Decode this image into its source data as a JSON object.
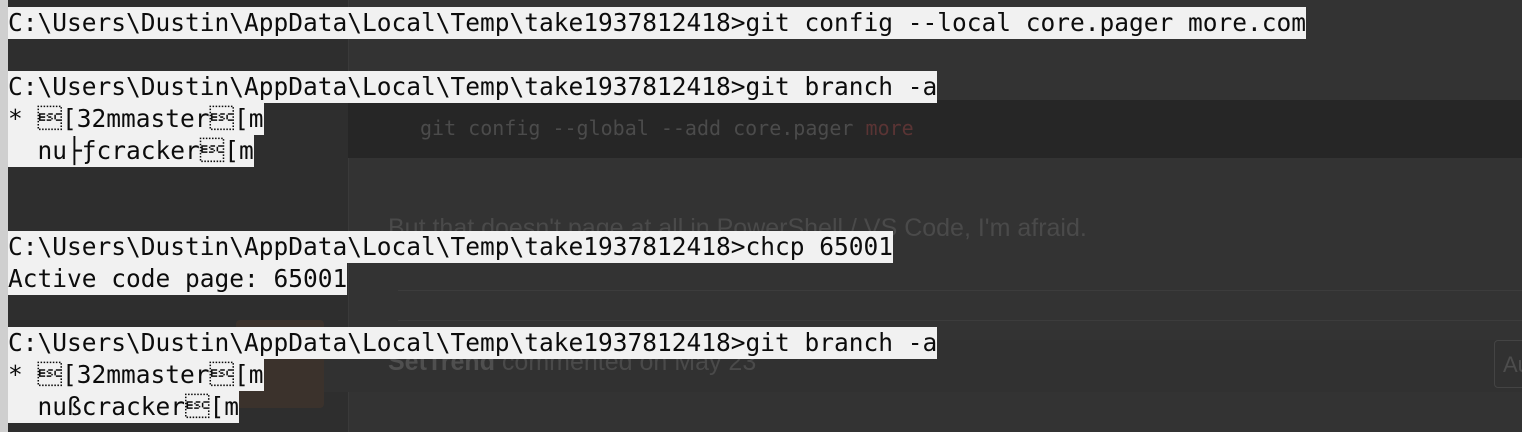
{
  "background_page": {
    "code_prefix": "git config --global --add core.pager ",
    "code_keyword": "more",
    "note": "But that doesn't page at all in PowerShell / VS Code, I'm afraid.",
    "comment_author": "SetTrend",
    "comment_text": " commented on May 23",
    "pill_text": "Au"
  },
  "console": {
    "lines": [
      "C:\\Users\\Dustin\\AppData\\Local\\Temp\\take1937812418>git config --local core.pager more.com",
      "C:\\Users\\Dustin\\AppData\\Local\\Temp\\take1937812418>git branch -a",
      "* \u001b[32mmaster\u001b[m",
      "  nu├ƒcracker\u001b[m",
      "C:\\Users\\Dustin\\AppData\\Local\\Temp\\take1937812418>chcp 65001",
      "Active code page: 65001",
      "C:\\Users\\Dustin\\AppData\\Local\\Temp\\take1937812418>git branch -a",
      "* \u001b[32mmaster\u001b[m",
      "  nußcracker\u001b[m"
    ]
  }
}
